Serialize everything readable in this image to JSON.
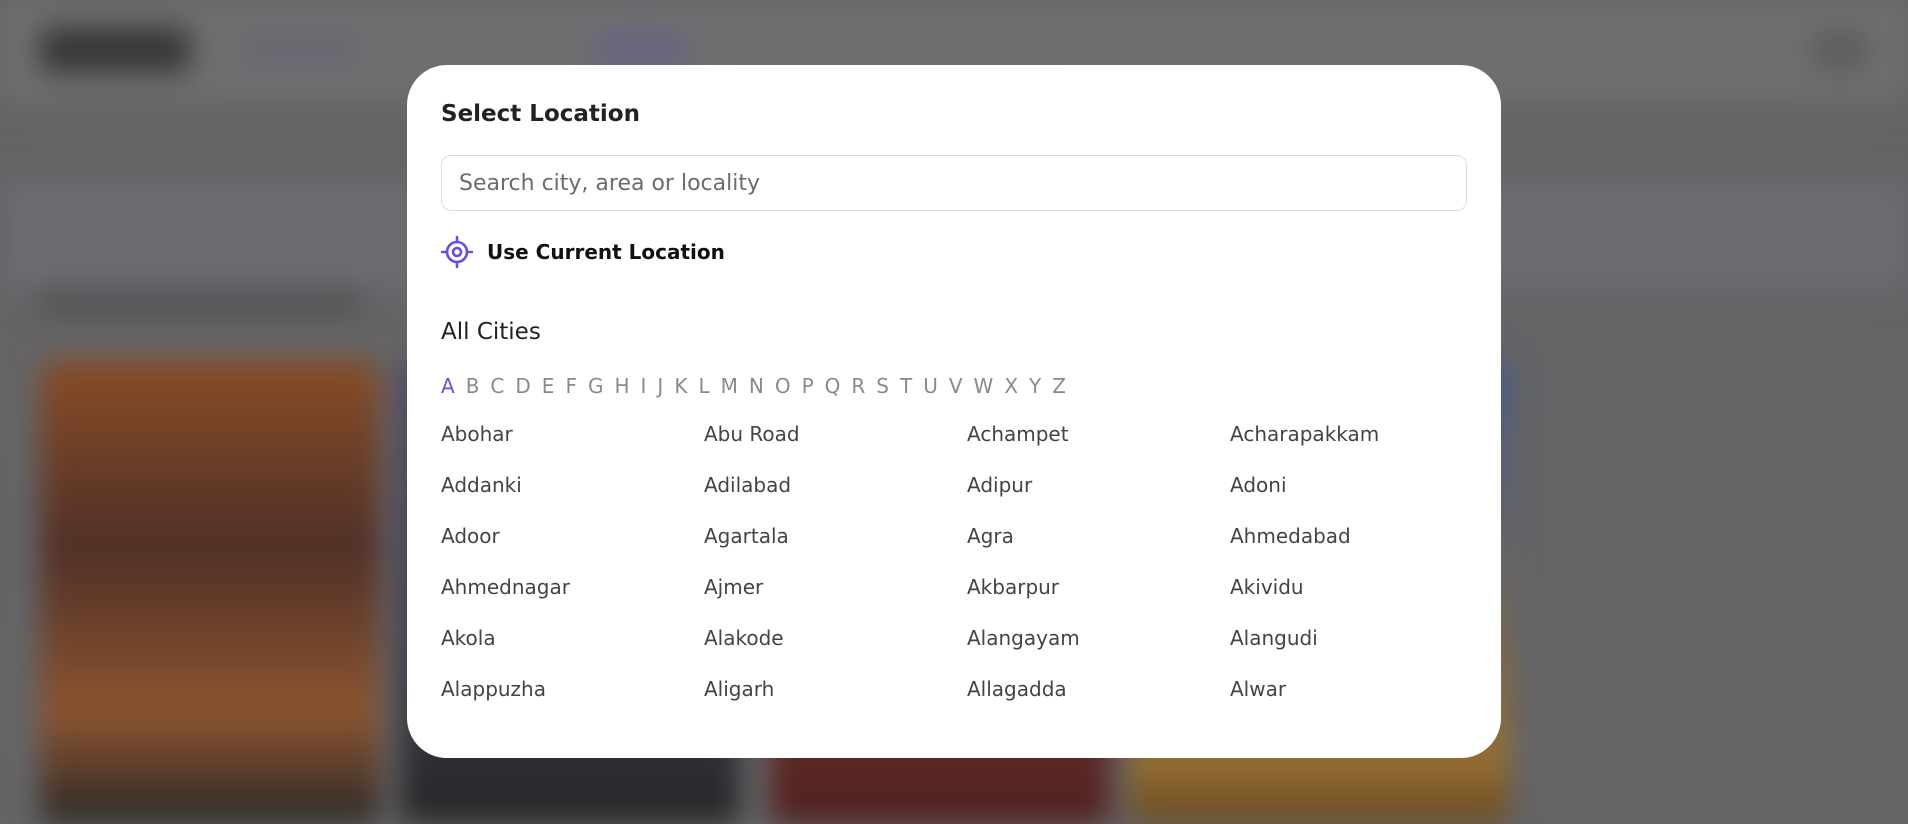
{
  "modal": {
    "title": "Select Location",
    "search": {
      "placeholder": "Search city, area or locality",
      "value": ""
    },
    "current_location": {
      "icon": "target-icon",
      "label": "Use Current Location",
      "icon_color": "#6a4ee0"
    },
    "cities_heading": "All Cities",
    "alphabet": [
      "A",
      "B",
      "C",
      "D",
      "E",
      "F",
      "G",
      "H",
      "I",
      "J",
      "K",
      "L",
      "M",
      "N",
      "O",
      "P",
      "Q",
      "R",
      "S",
      "T",
      "U",
      "V",
      "W",
      "X",
      "Y",
      "Z"
    ],
    "active_letter": "A",
    "cities": [
      "Abohar",
      "Abu Road",
      "Achampet",
      "Acharapakkam",
      "Addanki",
      "Adilabad",
      "Adipur",
      "Adoni",
      "Adoor",
      "Agartala",
      "Agra",
      "Ahmedabad",
      "Ahmednagar",
      "Ajmer",
      "Akbarpur",
      "Akividu",
      "Akola",
      "Alakode",
      "Alangayam",
      "Alangudi",
      "Alappuzha",
      "Aligarh",
      "Allagadda",
      "Alwar"
    ]
  },
  "colors": {
    "accent": "#6a4ee0",
    "overlay": "#7a7a7e",
    "modal_bg": "#ffffff"
  }
}
